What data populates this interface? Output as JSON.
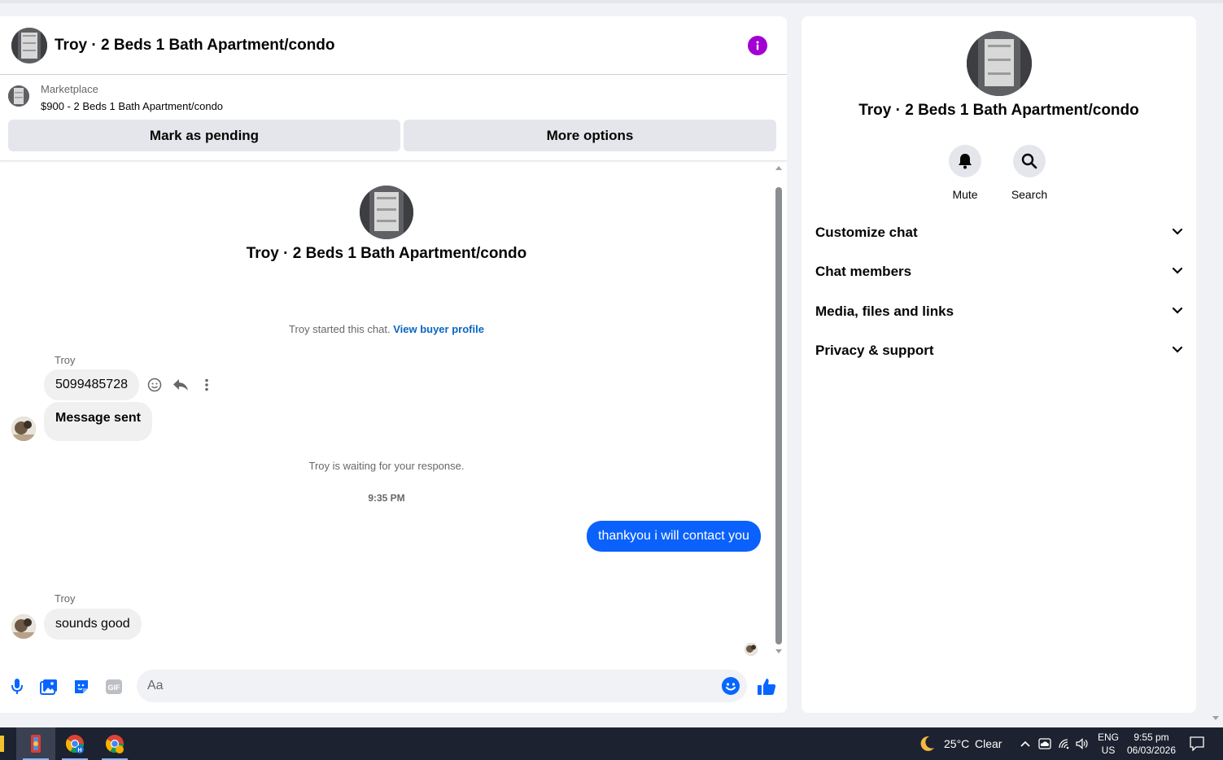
{
  "chat": {
    "title": "Troy · 2 Beds 1 Bath Apartment/condo",
    "listing": {
      "source": "Marketplace",
      "price_title": "$900 - 2 Beds 1 Bath Apartment/condo",
      "mark_pending_label": "Mark as pending",
      "more_options_label": "More options"
    },
    "thread": {
      "header_title": "Troy · 2 Beds 1 Bath Apartment/condo",
      "started_text": "Troy started this chat.",
      "view_profile_link": "View buyer profile",
      "messages": [
        {
          "sender": "Troy",
          "text": "5099485728",
          "direction": "incoming"
        },
        {
          "sender": "Troy",
          "text": "Message sent",
          "direction": "incoming"
        },
        {
          "sender": "You",
          "text": "thankyou i will contact you",
          "direction": "outgoing"
        },
        {
          "sender": "Troy",
          "text": "sounds good",
          "direction": "incoming"
        }
      ],
      "waiting_text": "Troy is waiting for your response.",
      "timestamp": "9:35 PM"
    },
    "composer": {
      "placeholder": "Aa"
    }
  },
  "info_panel": {
    "title": "Troy · 2 Beds 1 Bath Apartment/condo",
    "actions": [
      {
        "label": "Mute",
        "icon": "bell-icon"
      },
      {
        "label": "Search",
        "icon": "search-icon"
      }
    ],
    "sections": [
      {
        "title": "Customize chat"
      },
      {
        "title": "Chat members"
      },
      {
        "title": "Media, files and links"
      },
      {
        "title": "Privacy & support"
      }
    ]
  },
  "taskbar": {
    "weather": {
      "temp": "25°C",
      "condition": "Clear"
    },
    "language": {
      "lang": "ENG",
      "region": "US"
    },
    "clock": {
      "time": "9:55 pm",
      "date": "06/03/2026"
    }
  },
  "colors": {
    "accent_blue": "#0a61fc",
    "info_purple": "#a200d3",
    "link_blue": "#0a66c2"
  }
}
